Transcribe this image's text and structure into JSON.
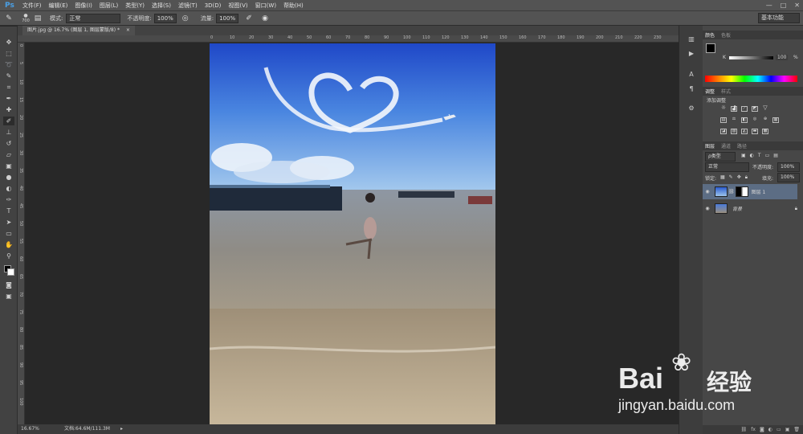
{
  "app": {
    "logo": "Ps"
  },
  "menu": [
    "文件(F)",
    "编辑(E)",
    "图像(I)",
    "图层(L)",
    "类型(Y)",
    "选择(S)",
    "滤镜(T)",
    "3D(D)",
    "视图(V)",
    "窗口(W)",
    "帮助(H)"
  ],
  "window_controls": [
    "—",
    "□",
    "✕"
  ],
  "options_bar": {
    "brush_size": "700",
    "mode_label": "模式:",
    "mode_value": "正常",
    "opacity_label": "不透明度:",
    "opacity_value": "100%",
    "flow_label": "流量:",
    "flow_value": "100%",
    "workspace": "基本功能"
  },
  "document": {
    "tab_title": "图片.jpg @ 16.7% (图层 1, 图层蒙版/8) *",
    "close": "×"
  },
  "rulers": {
    "top": [
      "0",
      "10",
      "20",
      "30",
      "40",
      "50",
      "60",
      "70",
      "80",
      "90",
      "100",
      "110",
      "120",
      "130",
      "140",
      "150",
      "160",
      "170",
      "180",
      "190",
      "200",
      "210",
      "220",
      "230"
    ],
    "left": [
      "0",
      "5",
      "10",
      "15",
      "20",
      "25",
      "30",
      "35",
      "40",
      "45",
      "50",
      "55",
      "60",
      "65",
      "70",
      "75",
      "80",
      "85",
      "90",
      "95",
      "100"
    ]
  },
  "tools": [
    "move-icon",
    "marquee-icon",
    "lasso-icon",
    "quick-select-icon",
    "crop-icon",
    "eyedropper-icon",
    "healing-icon",
    "brush-icon",
    "stamp-icon",
    "history-brush-icon",
    "eraser-icon",
    "gradient-icon",
    "blur-icon",
    "dodge-icon",
    "pen-icon",
    "type-icon",
    "path-select-icon",
    "shape-icon",
    "hand-icon",
    "zoom-icon"
  ],
  "status": {
    "zoom": "16.67%",
    "doc": "文档:64.6M/111.3M"
  },
  "color_panel": {
    "tabs": [
      "颜色",
      "色板"
    ],
    "k_label": "K",
    "k_value": "100",
    "percent": "%"
  },
  "adjust_panel": {
    "tabs": [
      "调整",
      "样式"
    ],
    "title": "添加调整"
  },
  "layers_panel": {
    "tabs": [
      "图层",
      "通道",
      "路径"
    ],
    "kind": "ρ类型",
    "blend": "正常",
    "opacity_label": "不透明度:",
    "opacity_value": "100%",
    "lock_label": "锁定:",
    "fill_label": "填充:",
    "fill_value": "100%",
    "layers": [
      {
        "name": "图层 1",
        "selected": true
      },
      {
        "name": "背景",
        "selected": false
      }
    ]
  },
  "watermark": {
    "brand": "Bai",
    "brand2": "du",
    "cn": "经验",
    "url": "jingyan.baidu.com"
  }
}
